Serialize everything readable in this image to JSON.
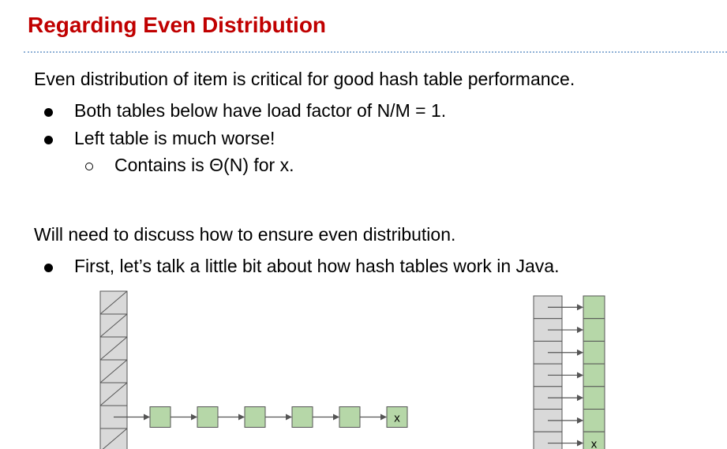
{
  "title": "Regarding Even Distribution",
  "body": {
    "line1": "Even distribution of item is critical for good hash table performance.",
    "bullet1": "Both tables below have load factor of N/M = 1.",
    "bullet2": "Left table is much worse!",
    "sub_bullet1": "Contains is Θ(N) for x.",
    "line2": "Will need to discuss how to ensure even distribution.",
    "bullet3": "First, let’s talk a little bit about how hash tables work in Java."
  },
  "diagram": {
    "left_table": {
      "buckets": 7,
      "chain_nodes": 6,
      "chain_bucket_index": 5,
      "last_node_label": "x"
    },
    "right_table": {
      "buckets": 7,
      "chain_nodes_per_bucket": 1,
      "last_node_label": "x"
    },
    "colors": {
      "bucket_fill": "#d9d9d9",
      "node_fill": "#b6d7a8",
      "stroke": "#555555"
    }
  }
}
